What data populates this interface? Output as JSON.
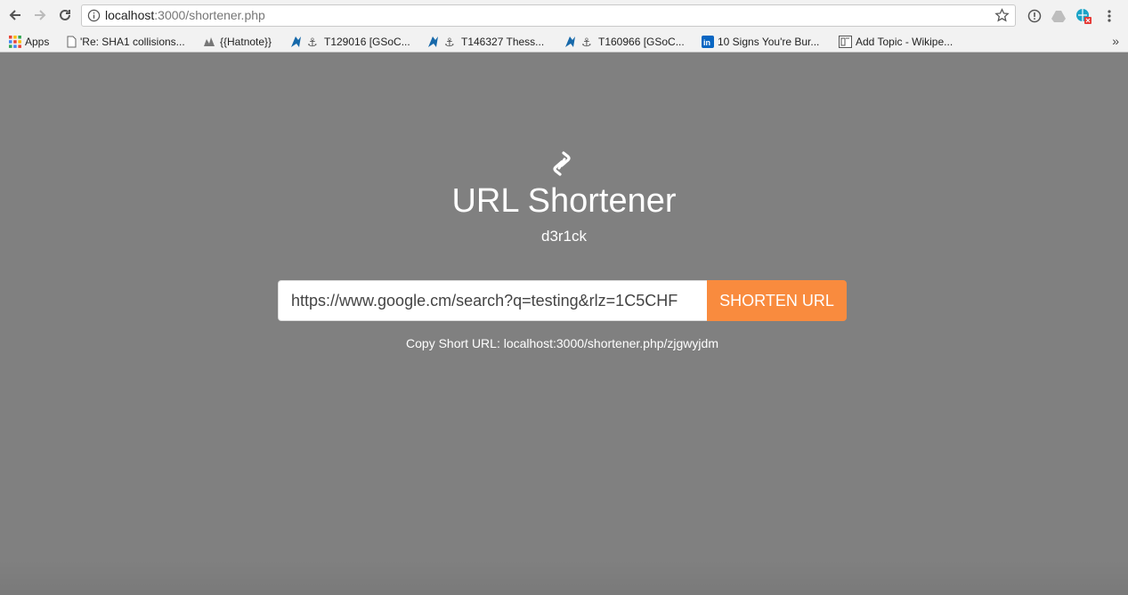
{
  "browser": {
    "url_host": "localhost",
    "url_rest": ":3000/shortener.php",
    "bookmarks": [
      {
        "label": "Apps",
        "icon": "apps-grid-icon"
      },
      {
        "label": "'Re: SHA1 collisions...",
        "icon": "page-icon"
      },
      {
        "label": "{{Hatnote}}",
        "icon": "hatnote-icon"
      },
      {
        "label": "T129016 [GSoC...",
        "icon": "phabricator-icon"
      },
      {
        "label": "T146327 Thess...",
        "icon": "phabricator-icon"
      },
      {
        "label": "T160966 [GSoC...",
        "icon": "phabricator-icon"
      },
      {
        "label": "10 Signs You're Bur...",
        "icon": "linkedin-icon"
      },
      {
        "label": "Add Topic - Wikipe...",
        "icon": "wikipedia-icon"
      }
    ],
    "more": "»"
  },
  "app": {
    "title": "URL Shortener",
    "subtitle": "d3r1ck",
    "input_value": "https://www.google.cm/search?q=testing&rlz=1C5CHF",
    "button_label": "SHORTEN URL",
    "result_text": "Copy Short URL: localhost:3000/shortener.php/zjgwyjdm"
  },
  "colors": {
    "page_background": "#808080",
    "accent": "#f98b3e"
  }
}
